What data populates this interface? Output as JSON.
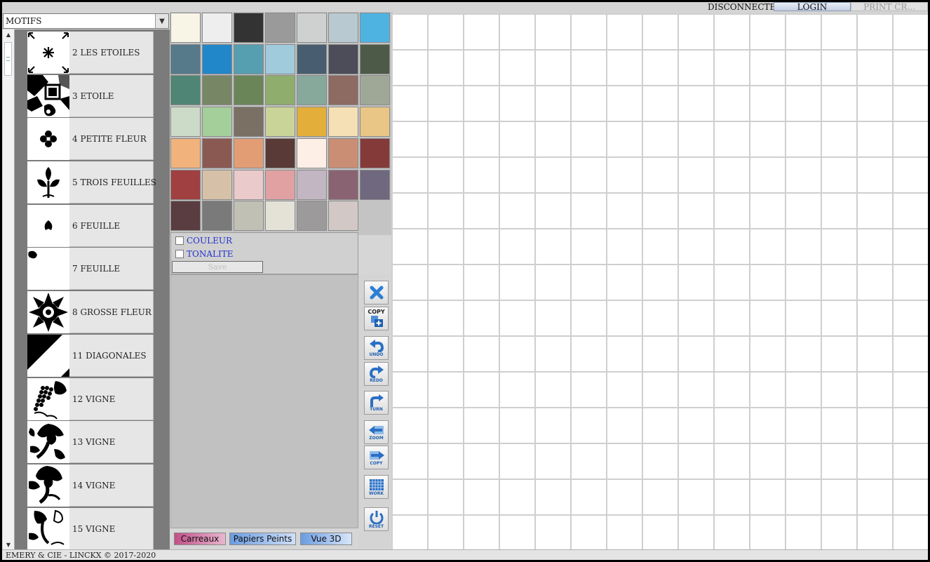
{
  "header": {
    "status": "DISCONNECTED",
    "login_label": "LOGIN",
    "print_label": "PRINT CR..."
  },
  "motifs": {
    "select_label": "MOTIFS",
    "items": [
      {
        "label": "2 LES ETOILES",
        "icon": "star-motif-icon"
      },
      {
        "label": "3 ETOILE",
        "icon": "geometric-star-motif-icon"
      },
      {
        "label": "4 PETITE FLEUR",
        "icon": "small-flower-motif-icon"
      },
      {
        "label": "5 TROIS FEUILLES",
        "icon": "three-leaves-motif-icon"
      },
      {
        "label": "6 FEUILLE",
        "icon": "leaf-motif-icon"
      },
      {
        "label": "7 FEUILLE",
        "icon": "corner-leaf-motif-icon"
      },
      {
        "label": "8 GROSSE FLEUR",
        "icon": "big-flower-motif-icon"
      },
      {
        "label": "11 DIAGONALES",
        "icon": "diagonal-motif-icon"
      },
      {
        "label": "12 VIGNE",
        "icon": "grape-vine-motif-icon"
      },
      {
        "label": "13 VIGNE",
        "icon": "vine-leaf-motif-icon"
      },
      {
        "label": "14 VIGNE",
        "icon": "vine-leaf-motif-icon"
      },
      {
        "label": "15 VIGNE",
        "icon": "vine-tendril-motif-icon"
      }
    ]
  },
  "palette": {
    "colors": [
      "#f8f4e6",
      "#eeeeee",
      "#333333",
      "#9a9a9a",
      "#cfd1d1",
      "#b9c9d1",
      "#4fb3e2",
      "#567a8a",
      "#2187c9",
      "#559fb1",
      "#9fcbdd",
      "#485e70",
      "#4c4d58",
      "#4e5a48",
      "#4f8575",
      "#778766",
      "#6a8558",
      "#8fae6e",
      "#86a99c",
      "#8d6a62",
      "#9fa896",
      "#ccdac8",
      "#a4cf9a",
      "#7a7064",
      "#c9d498",
      "#e3af3a",
      "#f5dfb5",
      "#e9c686",
      "#f2b27c",
      "#8a5a52",
      "#e39d74",
      "#5a3a36",
      "#fdeee6",
      "#ca8e74",
      "#853a3a",
      "#a04040",
      "#d6c1a8",
      "#ebcacb",
      "#e1a1a3",
      "#c1b6c2",
      "#8a6372",
      "#6f687e",
      "#5a3d40",
      "#7a7a7a",
      "#c1c0b4",
      "#e4e2d6",
      "#9d9a9b",
      "#d2c9c7"
    ]
  },
  "options": {
    "couleur_label": "COULEUR",
    "tonalite_label": "TONALITE",
    "save_label": "Save"
  },
  "tabs": {
    "carreaux": "Carreaux",
    "papiers": "Papiers Peints",
    "vue3d": "Vue 3D"
  },
  "tools": {
    "copy_top": "COPY",
    "undo": "UNDO",
    "redo": "REDO",
    "turn": "TURN",
    "zoom": "ZOOM",
    "copy": "COPY",
    "work": "WORK",
    "reset": "RESET"
  },
  "footer": {
    "copyright": "EMERY & CIE - LINCKX © 2017-2020"
  }
}
